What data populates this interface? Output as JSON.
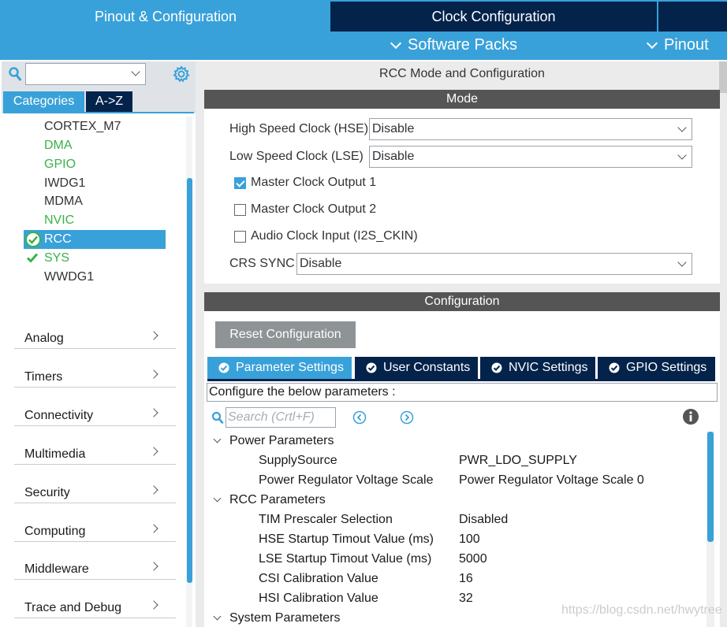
{
  "top_tabs": {
    "pinout_config": "Pinout & Configuration",
    "clock_config": "Clock Configuration"
  },
  "menu": {
    "software_packs": "Software Packs",
    "pinout": "Pinout"
  },
  "sidebar": {
    "search_value": "",
    "tabs": {
      "categories": "Categories",
      "az": "A->Z"
    },
    "peripherals": [
      {
        "label": "CORTEX_M7",
        "status": "normal"
      },
      {
        "label": "DMA",
        "status": "available"
      },
      {
        "label": "GPIO",
        "status": "available"
      },
      {
        "label": "IWDG1",
        "status": "normal"
      },
      {
        "label": "MDMA",
        "status": "normal"
      },
      {
        "label": "NVIC",
        "status": "available"
      },
      {
        "label": "RCC",
        "status": "selected-configured"
      },
      {
        "label": "SYS",
        "status": "configured"
      },
      {
        "label": "WWDG1",
        "status": "normal"
      }
    ],
    "categories": [
      "Analog",
      "Timers",
      "Connectivity",
      "Multimedia",
      "Security",
      "Computing",
      "Middleware",
      "Trace and Debug"
    ]
  },
  "mode": {
    "title": "RCC Mode and Configuration",
    "header": "Mode",
    "hse_label": "High Speed Clock (HSE)",
    "hse_value": "Disable",
    "lse_label": "Low Speed Clock (LSE)",
    "lse_value": "Disable",
    "mco1_label": "Master Clock Output 1",
    "mco1_checked": true,
    "mco2_label": "Master Clock Output 2",
    "mco2_checked": false,
    "audio_label": "Audio Clock Input (I2S_CKIN)",
    "audio_checked": false,
    "crs_label": "CRS SYNC",
    "crs_value": "Disable"
  },
  "configuration": {
    "header": "Configuration",
    "reset_button": "Reset Configuration",
    "tabs": [
      "Parameter Settings",
      "User Constants",
      "NVIC Settings",
      "GPIO Settings"
    ],
    "active_tab": "Parameter Settings",
    "info_line": "Configure the below parameters :",
    "search_placeholder": "Search (Crtl+F)",
    "groups": [
      {
        "name": "Power Parameters",
        "params": [
          {
            "name": "SupplySource",
            "value": "PWR_LDO_SUPPLY"
          },
          {
            "name": "Power Regulator Voltage Scale",
            "value": "Power Regulator Voltage Scale 0"
          }
        ]
      },
      {
        "name": "RCC Parameters",
        "params": [
          {
            "name": "TIM Prescaler Selection",
            "value": "Disabled"
          },
          {
            "name": "HSE Startup Timout Value (ms)",
            "value": "100"
          },
          {
            "name": "LSE Startup Timout Value (ms)",
            "value": "5000"
          },
          {
            "name": "CSI Calibration Value",
            "value": "16"
          },
          {
            "name": "HSI Calibration Value",
            "value": "32"
          }
        ]
      },
      {
        "name": "System Parameters",
        "params": []
      }
    ]
  },
  "watermark": "https://blog.csdn.net/hwytree",
  "colors": {
    "accent": "#39a1d9",
    "navy": "#03234b",
    "header_gray": "#555555",
    "green": "#39b24a"
  }
}
